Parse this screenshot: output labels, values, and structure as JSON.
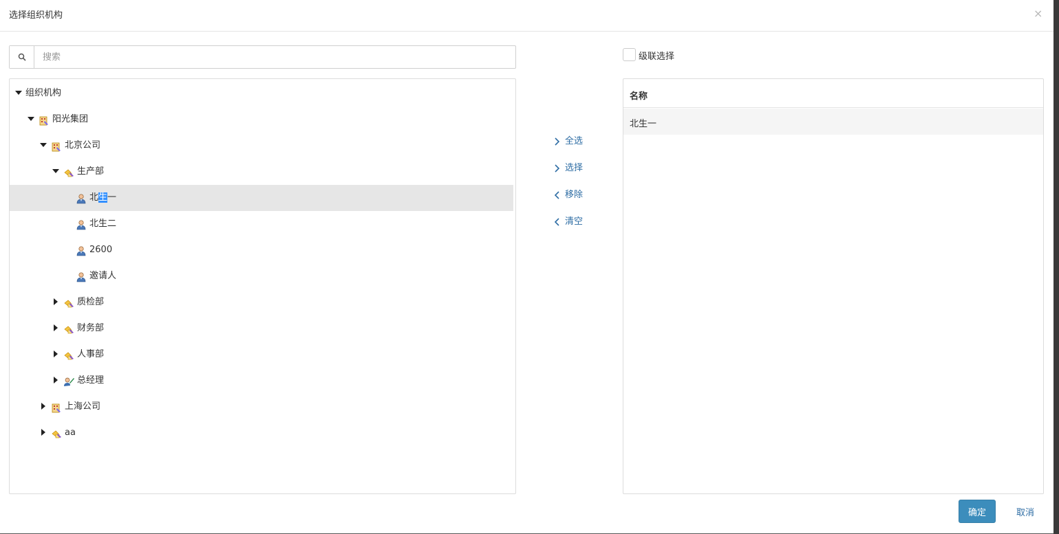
{
  "dialog": {
    "title": "选择组织机构",
    "close_glyph": "×"
  },
  "search": {
    "placeholder": "搜索",
    "value": "",
    "icon": "search-icon"
  },
  "tree": {
    "root": {
      "label": "组织机构",
      "expanded": true
    },
    "nodes": [
      {
        "label": "阳光集团",
        "type": "company",
        "icon": "company-icon",
        "expanded": true
      },
      {
        "label": "北京公司",
        "type": "company",
        "icon": "company-icon",
        "expanded": true
      },
      {
        "label": "生产部",
        "type": "department",
        "icon": "department-icon",
        "expanded": true
      },
      {
        "label_pre": "北",
        "label_hl": "生",
        "label_post": "一",
        "type": "user",
        "icon": "user-icon",
        "selected": true
      },
      {
        "label": "北生二",
        "type": "user",
        "icon": "user-icon"
      },
      {
        "label": "2600",
        "type": "user",
        "icon": "user-icon"
      },
      {
        "label": "邀请人",
        "type": "user",
        "icon": "user-icon"
      },
      {
        "label": "质检部",
        "type": "department",
        "icon": "department-icon",
        "expanded": false
      },
      {
        "label": "财务部",
        "type": "department",
        "icon": "department-icon",
        "expanded": false
      },
      {
        "label": "人事部",
        "type": "department",
        "icon": "department-icon",
        "expanded": false
      },
      {
        "label": "总经理",
        "type": "position",
        "icon": "position-icon",
        "expanded": false
      },
      {
        "label": "上海公司",
        "type": "company",
        "icon": "company-icon",
        "expanded": false
      },
      {
        "label": "aa",
        "type": "department",
        "icon": "department-icon",
        "expanded": false
      }
    ]
  },
  "transfer": {
    "select_all": "全选",
    "select": "选择",
    "remove": "移除",
    "clear": "清空"
  },
  "cascade": {
    "label": "级联选择",
    "checked": false
  },
  "selected_list": {
    "column_header": "名称",
    "items": [
      "北生一"
    ]
  },
  "footer": {
    "confirm": "确定",
    "cancel": "取消"
  },
  "colors": {
    "primary_button": "#3c8dbc",
    "link": "#2e6da4",
    "selected_row": "#e6e6e6",
    "text_highlight": "#3390ff"
  }
}
